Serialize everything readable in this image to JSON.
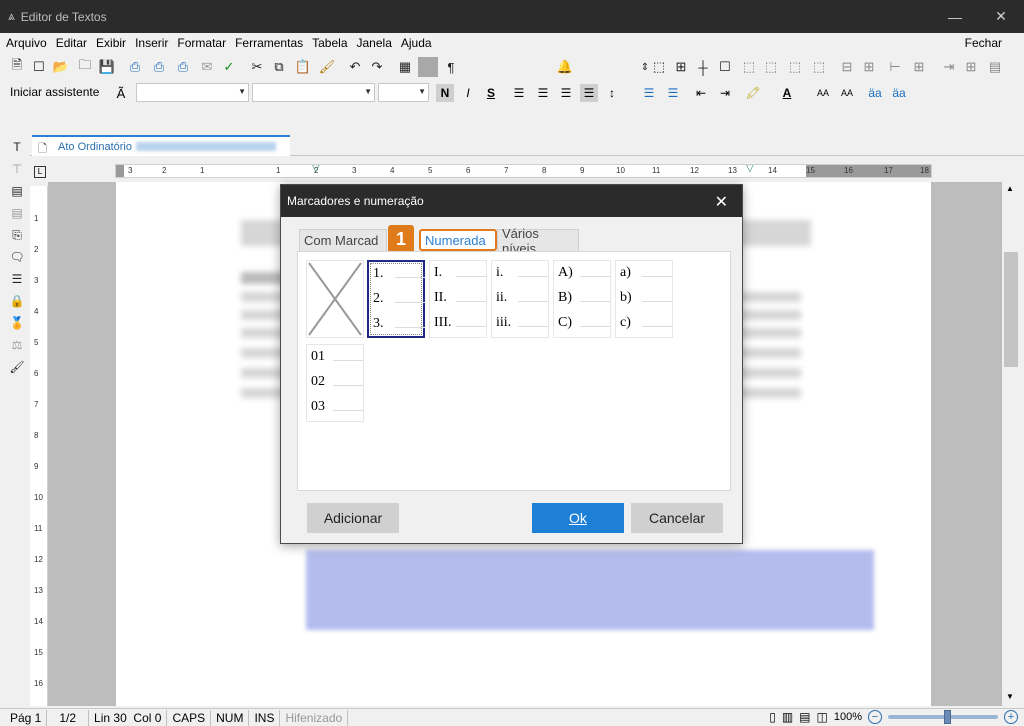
{
  "window": {
    "title": "Editor de Textos"
  },
  "menu": {
    "items": [
      "Arquivo",
      "Editar",
      "Exibir",
      "Inserir",
      "Formatar",
      "Ferramentas",
      "Tabela",
      "Janela",
      "Ajuda"
    ],
    "close_label": "Fechar"
  },
  "toolbar2": {
    "assistant_label": "Iniciar assistente"
  },
  "document_tab": {
    "label": "Ato Ordinatório"
  },
  "ruler": {
    "ticks": [
      "3",
      "2",
      "1",
      "1",
      "2",
      "3",
      "4",
      "5",
      "6",
      "7",
      "8",
      "9",
      "10",
      "11",
      "12",
      "13",
      "14",
      "15",
      "16",
      "17",
      "18"
    ]
  },
  "vruler": {
    "ticks": [
      "1",
      "2",
      "3",
      "4",
      "5",
      "6",
      "7",
      "8",
      "9",
      "10",
      "11",
      "12",
      "13",
      "14",
      "15",
      "16"
    ]
  },
  "dialog": {
    "title": "Marcadores e numeração",
    "tabs": [
      "Com Marcad",
      "Numerada",
      "Vários níveis"
    ],
    "active_tab": "Numerada",
    "callout": "1",
    "options": [
      {
        "id": "none",
        "rows": []
      },
      {
        "id": "arabic-dot",
        "rows": [
          "1.",
          "2.",
          "3."
        ]
      },
      {
        "id": "roman-upper",
        "rows": [
          "I.",
          "II.",
          "III."
        ]
      },
      {
        "id": "roman-lower",
        "rows": [
          "i.",
          "ii.",
          "iii."
        ]
      },
      {
        "id": "alpha-upper",
        "rows": [
          "A)",
          "B)",
          "C)"
        ]
      },
      {
        "id": "alpha-lower",
        "rows": [
          "a)",
          "b)",
          "c)"
        ]
      },
      {
        "id": "zero-padded",
        "rows": [
          "01",
          "02",
          "03"
        ]
      }
    ],
    "selected_option": "arabic-dot",
    "buttons": {
      "add": "Adicionar",
      "ok": "Ok",
      "cancel": "Cancelar"
    }
  },
  "status": {
    "page": "Pág 1",
    "pages": "1/2",
    "position": "Lin 30  Col 0",
    "caps": "CAPS",
    "num": "NUM",
    "ins": "INS",
    "hyphen": "Hifenizado",
    "zoom": "100%"
  },
  "colors": {
    "accent": "#1d7fd6",
    "callout": "#e07b1c",
    "titlebar": "#2b2b2b"
  }
}
